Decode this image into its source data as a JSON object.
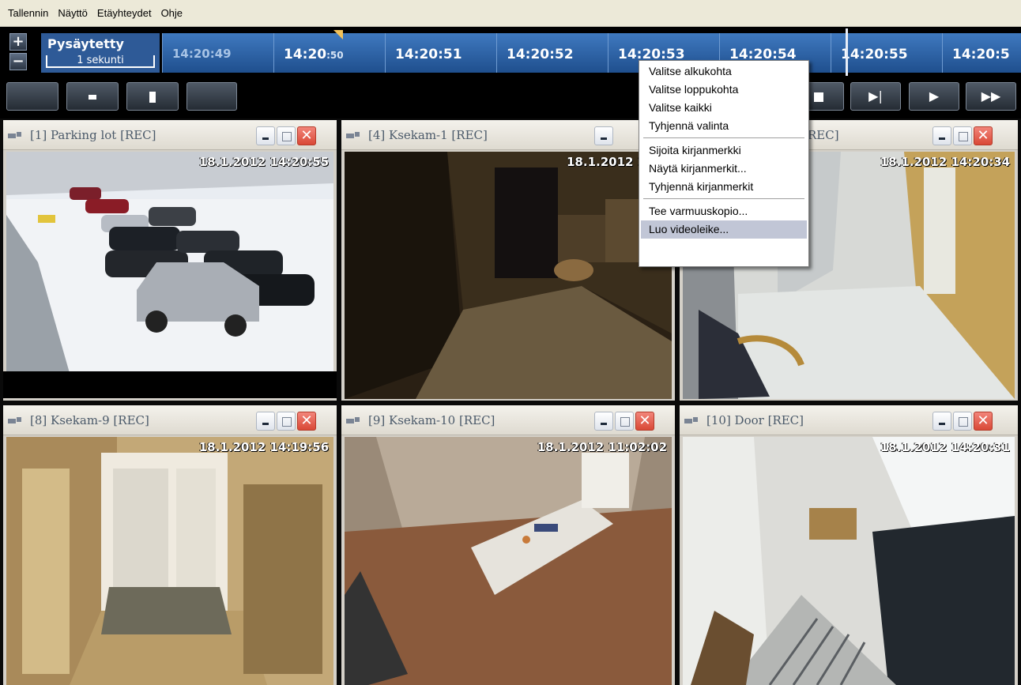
{
  "menu": [
    "Tallennin",
    "Näyttö",
    "Etäyhteydet",
    "Ohje"
  ],
  "timeline": {
    "state": "Pysäytetty",
    "scale": "1 sekunti",
    "ticks": [
      {
        "label": "14:20:49",
        "main": "14:20:49",
        "sec": ""
      },
      {
        "label": "14:20:50",
        "main": "14:20",
        "sec": ":50"
      },
      {
        "label": "14:20:51",
        "main": "14:20:51",
        "sec": ""
      },
      {
        "label": "14:20:52",
        "main": "14:20:52",
        "sec": ""
      },
      {
        "label": "14:20:53",
        "main": "14:20:53",
        "sec": ""
      },
      {
        "label": "14:20:54",
        "main": "14:20:54",
        "sec": ""
      },
      {
        "label": "14:20:55",
        "main": "14:20:55",
        "sec": ""
      },
      {
        "label": "14:20:5",
        "main": "14:20:5",
        "sec": ""
      }
    ]
  },
  "controls": {
    "icons": [
      "stop-icon",
      "pause-icon",
      "prev-icon",
      "step-forward-icon",
      "play-icon",
      "fast-forward-icon"
    ]
  },
  "context_menu": {
    "items": [
      "Valitse alkukohta",
      "Valitse loppukohta",
      "Valitse kaikki",
      "Tyhjennä valinta",
      "Sijoita kirjanmerkki",
      "Näytä kirjanmerkit...",
      "Tyhjennä kirjanmerkit",
      "Tee varmuuskopio...",
      "Luo videoleike..."
    ],
    "highlighted": "Luo videoleike..."
  },
  "panes": [
    {
      "title": "[1] Parking lot [REC]",
      "timestamp": "18.1.2012 14:20:55"
    },
    {
      "title": "[4] Ksekam-1 [REC]",
      "timestamp": "18.1.2012 14:1"
    },
    {
      "title": "REC]",
      "timestamp": "18.1.2012 14:20:34"
    },
    {
      "title": "[8] Ksekam-9 [REC]",
      "timestamp": "18.1.2012 14:19:56"
    },
    {
      "title": "[9] Ksekam-10 [REC]",
      "timestamp": "18.1.2012 11:02:02"
    },
    {
      "title": "[10] Door [REC]",
      "timestamp": "18.1.2012 14:20:31"
    }
  ],
  "colors": {
    "timeline_blue": "#2e5a97",
    "menu_highlight": "#c1c6d6",
    "close_red": "#d94836"
  }
}
